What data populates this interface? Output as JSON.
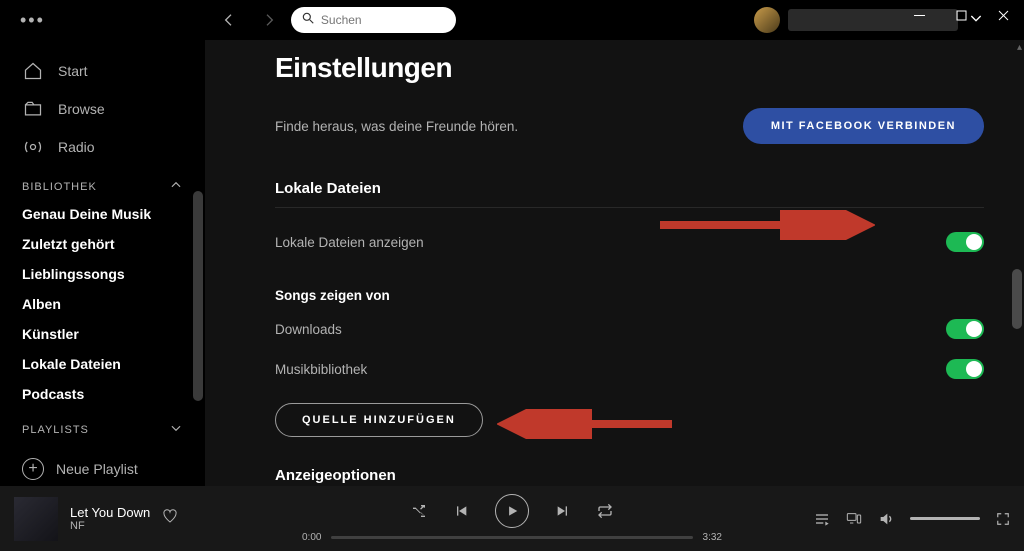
{
  "titlebar": {
    "menu_dots": "•••"
  },
  "search": {
    "placeholder": "Suchen"
  },
  "window": {
    "minimize": "–",
    "maximize": "☐",
    "close": "✕"
  },
  "sidebar": {
    "main_items": [
      {
        "label": "Start"
      },
      {
        "label": "Browse"
      },
      {
        "label": "Radio"
      }
    ],
    "library_header": "BIBLIOTHEK",
    "library_items": [
      {
        "label": "Genau Deine Musik"
      },
      {
        "label": "Zuletzt gehört"
      },
      {
        "label": "Lieblingssongs"
      },
      {
        "label": "Alben"
      },
      {
        "label": "Künstler"
      },
      {
        "label": "Lokale Dateien"
      },
      {
        "label": "Podcasts"
      }
    ],
    "playlists_header": "PLAYLISTS",
    "new_playlist": "Neue Playlist"
  },
  "settings": {
    "page_title": "Einstellungen",
    "friends_text": "Finde heraus, was deine Freunde hören.",
    "facebook_btn": "MIT FACEBOOK VERBINDEN",
    "local_files_header": "Lokale Dateien",
    "show_local_label": "Lokale Dateien anzeigen",
    "songs_from_header": "Songs zeigen von",
    "source_downloads": "Downloads",
    "source_music_lib": "Musikbibliothek",
    "add_source_btn": "QUELLE HINZUFÜGEN",
    "display_options_header": "Anzeigeoptionen"
  },
  "player": {
    "track_title": "Let You Down",
    "track_artist": "NF",
    "time_current": "0:00",
    "time_total": "3:32"
  }
}
